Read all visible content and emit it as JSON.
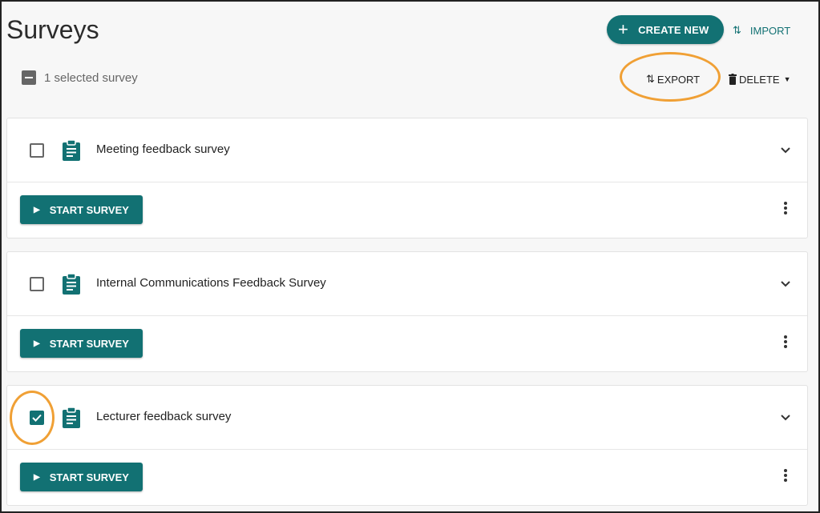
{
  "page": {
    "title": "Surveys"
  },
  "toolbar": {
    "create_label": "CREATE NEW",
    "import_label": "IMPORT",
    "export_label": "EXPORT",
    "delete_label": "DELETE",
    "selection_text": "1 selected survey"
  },
  "colors": {
    "accent": "#127173",
    "highlight": "#f0a035"
  },
  "surveys": [
    {
      "name": "Meeting feedback survey",
      "checked": false,
      "start_label": "START SURVEY"
    },
    {
      "name": "Internal Communications Feedback Survey",
      "checked": false,
      "start_label": "START SURVEY"
    },
    {
      "name": "Lecturer feedback survey",
      "checked": true,
      "start_label": "START SURVEY"
    }
  ]
}
